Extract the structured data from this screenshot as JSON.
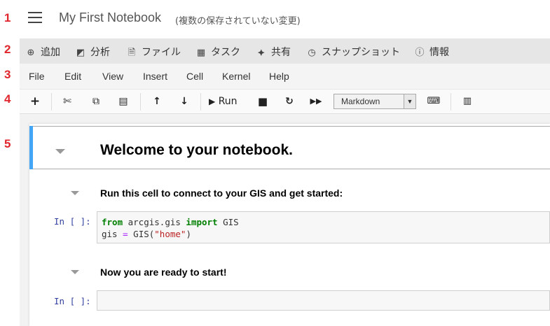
{
  "header": {
    "title": "My First Notebook",
    "status": "(複数の保存されていない変更)"
  },
  "markers": [
    "1",
    "2",
    "3",
    "4",
    "5"
  ],
  "portal_menu": [
    {
      "icon": "⊕",
      "icon_name": "add-icon",
      "label": "追加"
    },
    {
      "icon": "◩",
      "icon_name": "analysis-icon",
      "label": "分析"
    },
    {
      "icon": "🗎",
      "icon_name": "file-icon",
      "label": "ファイル"
    },
    {
      "icon": "▦",
      "icon_name": "calendar-icon",
      "label": "タスク"
    },
    {
      "icon": "⯌",
      "icon_name": "share-icon",
      "label": "共有"
    },
    {
      "icon": "◷",
      "icon_name": "clock-icon",
      "label": "スナップショット"
    },
    {
      "icon": "ⓘ",
      "icon_name": "info-icon",
      "label": "情報"
    }
  ],
  "menu": [
    "File",
    "Edit",
    "View",
    "Insert",
    "Cell",
    "Kernel",
    "Help"
  ],
  "toolbar": {
    "run_label": "Run",
    "cell_type": "Markdown"
  },
  "cells": {
    "welcome_heading": "Welcome to your notebook.",
    "connect_heading": "Run this cell to connect to your GIS and get started:",
    "prompt1": "In [ ]:",
    "code_line1": {
      "kw1": "from",
      "mod": " arcgis.gis ",
      "kw2": "import",
      "name": " GIS"
    },
    "code_line2": {
      "var": "gis ",
      "op": "=",
      "call": " GIS(",
      "str": "\"home\"",
      "end": ")"
    },
    "ready_heading": "Now you are ready to start!",
    "prompt2": "In [ ]:"
  }
}
